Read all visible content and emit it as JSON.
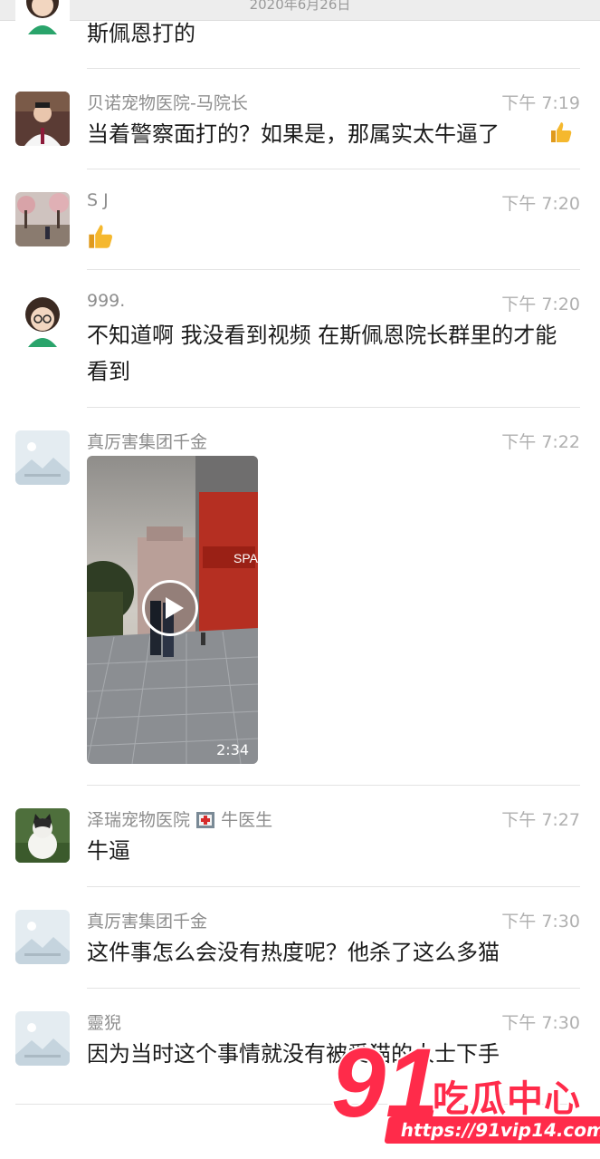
{
  "header": {
    "date": "2020年6月26日"
  },
  "messages": [
    {
      "name": "",
      "time": "",
      "text": "斯佩恩打的"
    },
    {
      "name": "贝诺宠物医院-马院长",
      "time": "下午 7:19",
      "text": "当着警察面打的？如果是，那属实太牛逼了"
    },
    {
      "name": "S J",
      "time": "下午 7:20",
      "text": ""
    },
    {
      "name": "999.",
      "time": "下午 7:20",
      "text": "不知道啊 我没看到视频 在斯佩恩院长群里的才能看到"
    },
    {
      "name": "真厉害集团千金",
      "time": "下午 7:22",
      "video_duration": "2:34",
      "video_sign": "SPA"
    },
    {
      "name": "泽瑞宠物医院",
      "name_suffix": "牛医生",
      "time": "下午 7:27",
      "text": "牛逼"
    },
    {
      "name": "真厉害集团千金",
      "time": "下午 7:30",
      "text": "这件事怎么会没有热度呢？他杀了这么多猫"
    },
    {
      "name": "靈猊",
      "time": "下午 7:30",
      "text": "因为当时这个事情就没有被爱猫的人士下手"
    }
  ],
  "watermark": {
    "number": "91",
    "title": "吃瓜中心",
    "url": "https://91vip14.com"
  },
  "colors": {
    "accent": "#ff2b4a",
    "thumb": "#f5b82e",
    "divider": "#e3e3e3"
  },
  "icons": [
    "thumbs-up-icon",
    "play-icon",
    "hospital-icon"
  ]
}
